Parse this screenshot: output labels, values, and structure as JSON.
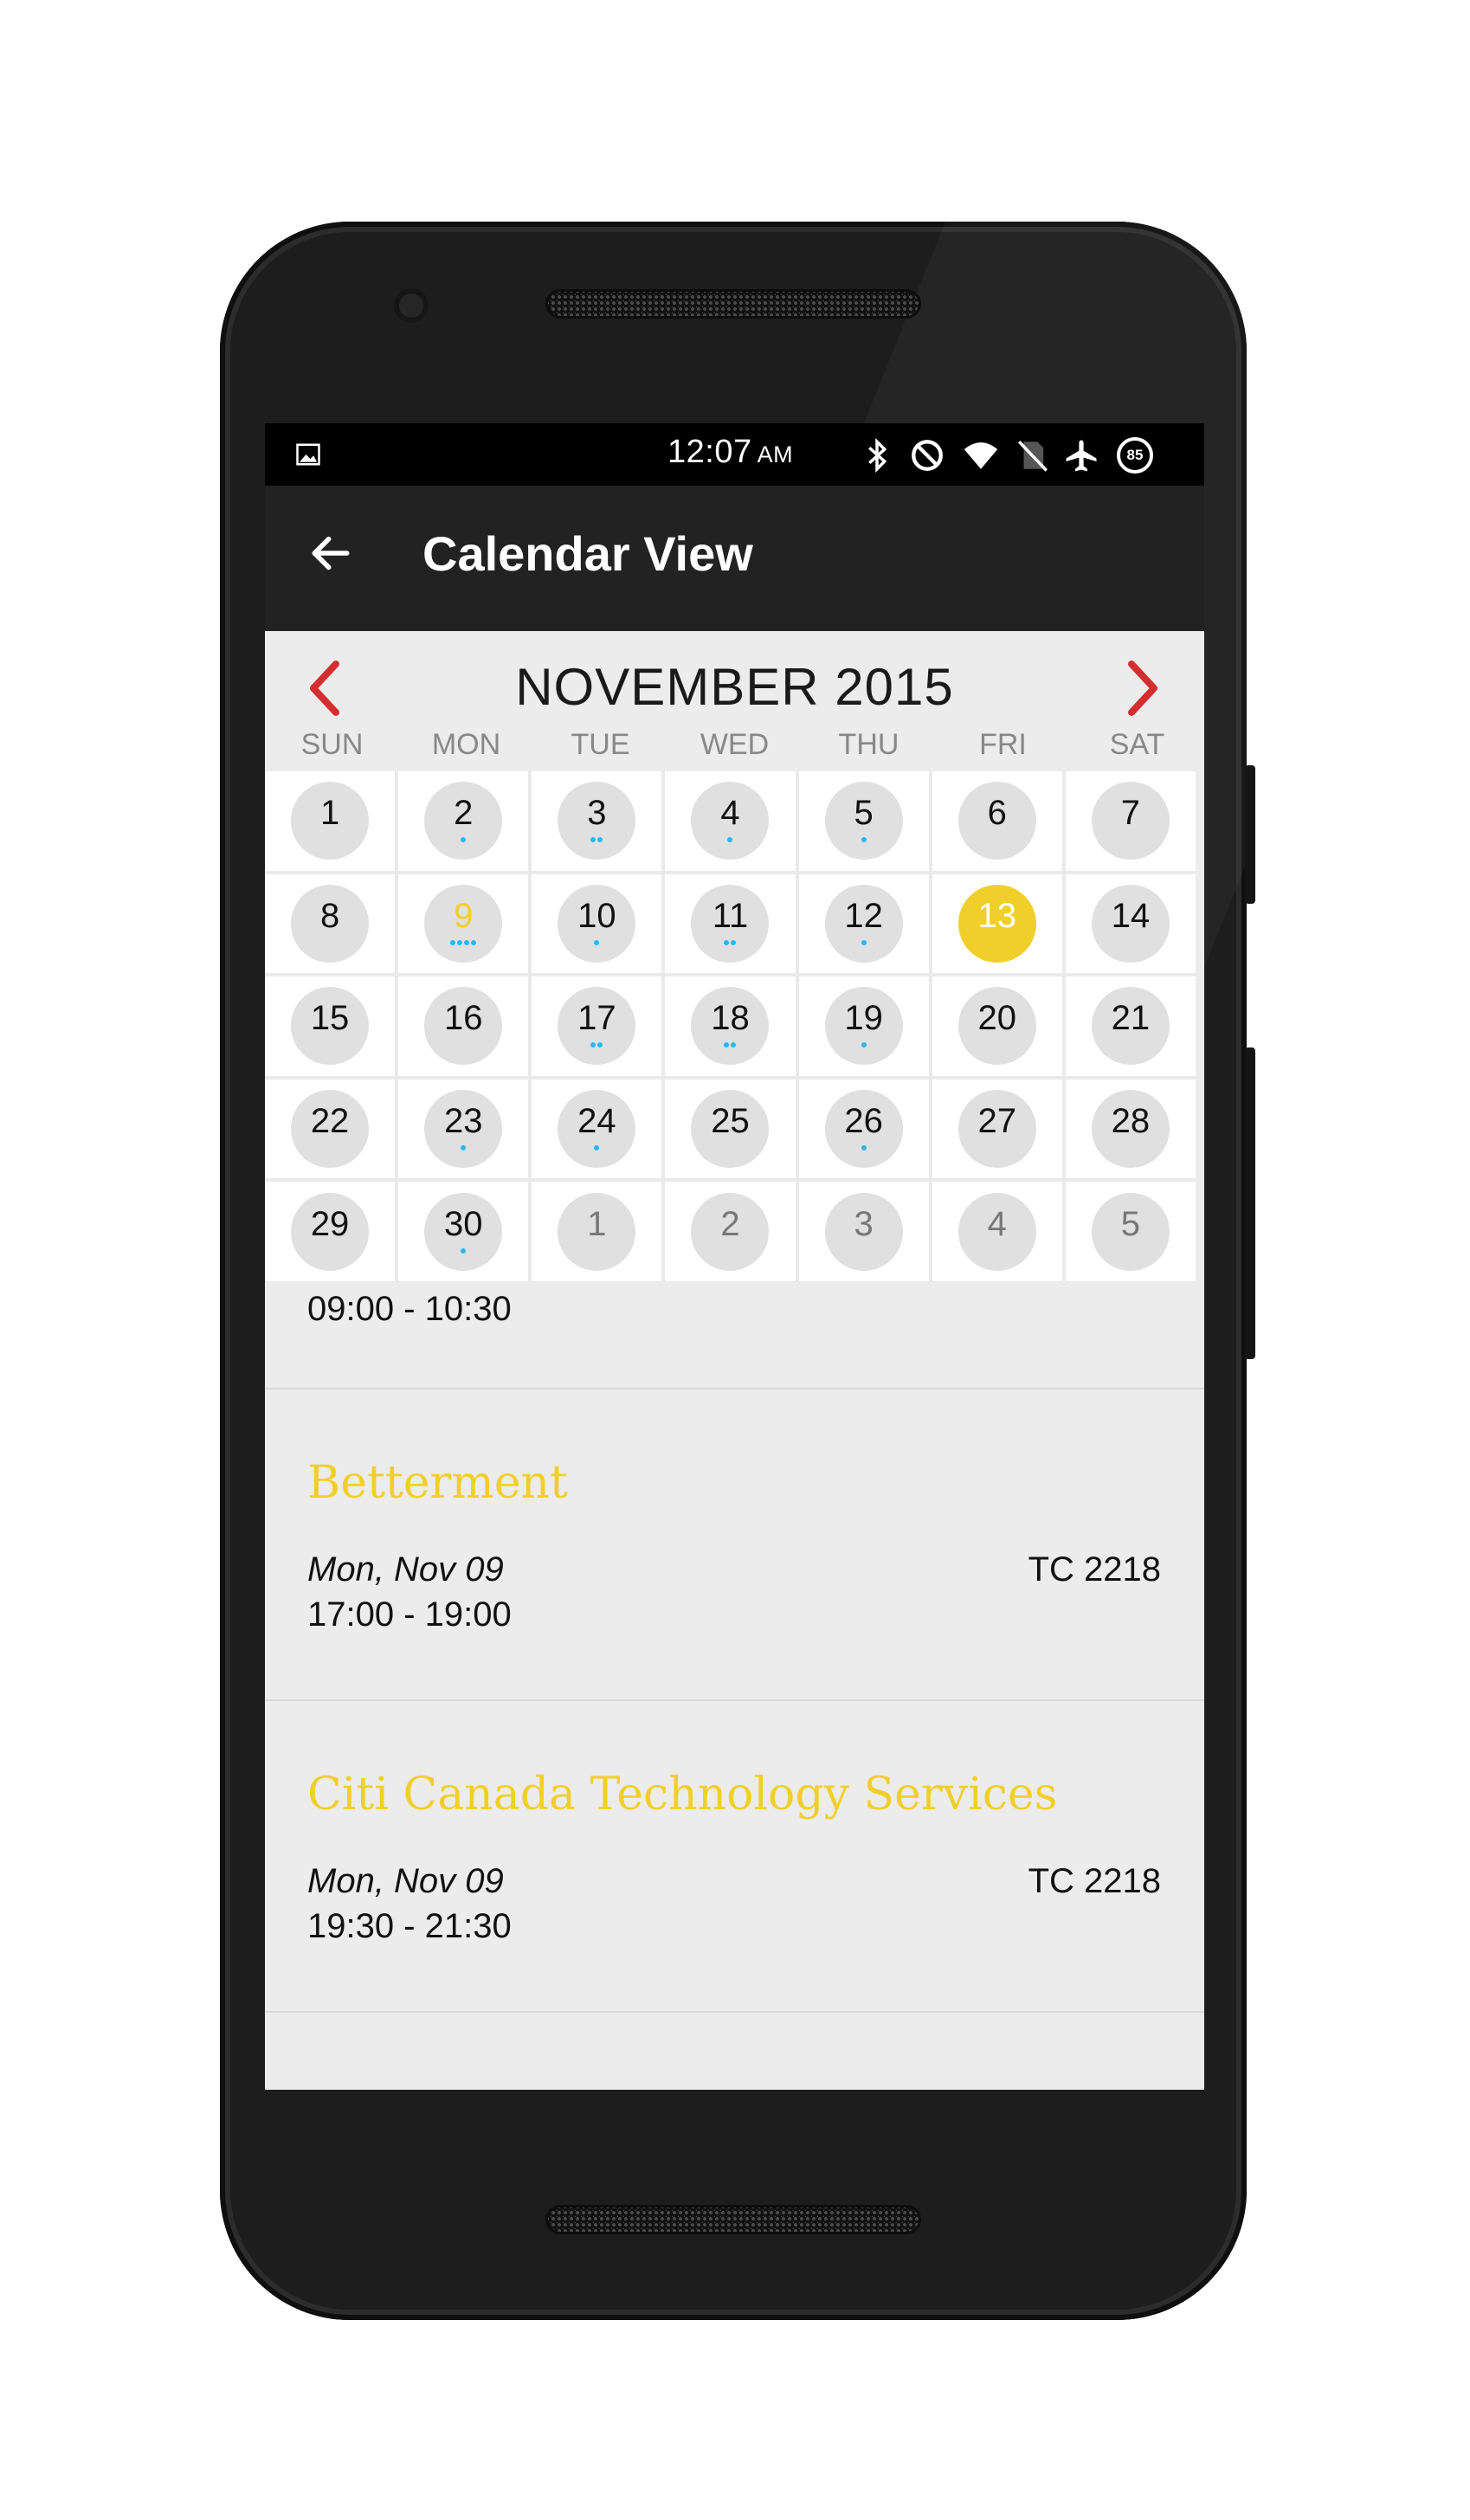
{
  "status_bar": {
    "time": "12:07",
    "ampm": "AM",
    "battery": "85",
    "icons": [
      "gallery-icon",
      "bluetooth-icon",
      "do-not-disturb-icon",
      "wifi-icon",
      "no-sim-icon",
      "airplane-icon",
      "battery-icon"
    ]
  },
  "app_bar": {
    "title": "Calendar View",
    "back_icon": "arrow-back-icon"
  },
  "calendar": {
    "month_label": "NOVEMBER 2015",
    "prev_icon": "chevron-left-icon",
    "next_icon": "chevron-right-icon",
    "accent_color": "#d32f2f",
    "highlight_color": "#f1cf2b",
    "event_dot_color": "#29b6f6",
    "weekdays": [
      "SUN",
      "MON",
      "TUE",
      "WED",
      "THU",
      "FRI",
      "SAT"
    ],
    "days": [
      {
        "num": "1",
        "dots": 0
      },
      {
        "num": "2",
        "dots": 1
      },
      {
        "num": "3",
        "dots": 2
      },
      {
        "num": "4",
        "dots": 1
      },
      {
        "num": "5",
        "dots": 1
      },
      {
        "num": "6",
        "dots": 0
      },
      {
        "num": "7",
        "dots": 0
      },
      {
        "num": "8",
        "dots": 0
      },
      {
        "num": "9",
        "dots": 4,
        "state": "highlight"
      },
      {
        "num": "10",
        "dots": 1
      },
      {
        "num": "11",
        "dots": 2
      },
      {
        "num": "12",
        "dots": 1
      },
      {
        "num": "13",
        "dots": 0,
        "state": "selected"
      },
      {
        "num": "14",
        "dots": 0
      },
      {
        "num": "15",
        "dots": 0
      },
      {
        "num": "16",
        "dots": 0
      },
      {
        "num": "17",
        "dots": 2
      },
      {
        "num": "18",
        "dots": 2
      },
      {
        "num": "19",
        "dots": 1
      },
      {
        "num": "20",
        "dots": 0
      },
      {
        "num": "21",
        "dots": 0
      },
      {
        "num": "22",
        "dots": 0
      },
      {
        "num": "23",
        "dots": 1
      },
      {
        "num": "24",
        "dots": 1
      },
      {
        "num": "25",
        "dots": 0
      },
      {
        "num": "26",
        "dots": 1
      },
      {
        "num": "27",
        "dots": 0
      },
      {
        "num": "28",
        "dots": 0
      },
      {
        "num": "29",
        "dots": 0
      },
      {
        "num": "30",
        "dots": 1
      },
      {
        "num": "1",
        "dots": 0,
        "state": "other"
      },
      {
        "num": "2",
        "dots": 0,
        "state": "other"
      },
      {
        "num": "3",
        "dots": 0,
        "state": "other"
      },
      {
        "num": "4",
        "dots": 0,
        "state": "other"
      },
      {
        "num": "5",
        "dots": 0,
        "state": "other"
      }
    ]
  },
  "events": {
    "partial_time": "09:00 - 10:30",
    "items": [
      {
        "title": "Betterment",
        "date": "Mon, Nov 09",
        "time": "17:00 - 19:00",
        "room": "TC 2218"
      },
      {
        "title": "Citi Canada Technology Services",
        "date": "Mon, Nov 09",
        "time": "19:30 - 21:30",
        "room": "TC 2218"
      }
    ]
  }
}
